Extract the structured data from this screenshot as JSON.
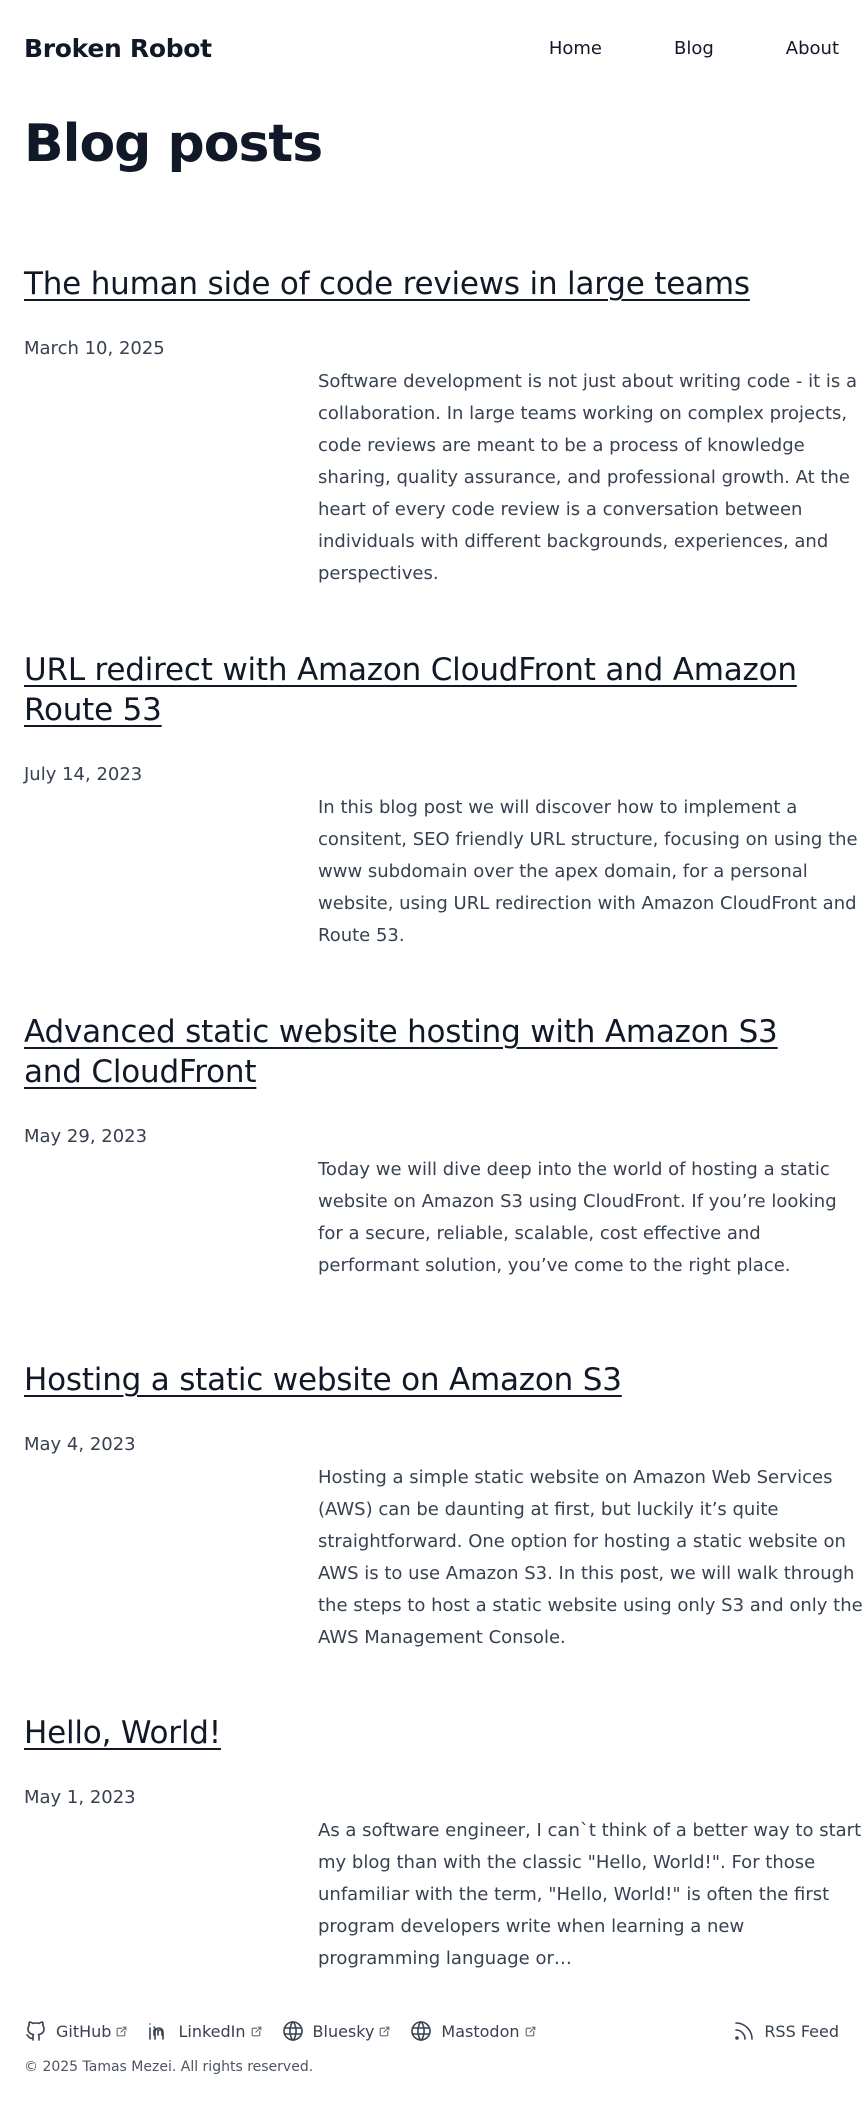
{
  "site": {
    "brand": "Broken Robot",
    "nav": [
      {
        "label": "Home"
      },
      {
        "label": "Blog"
      },
      {
        "label": "About"
      }
    ]
  },
  "page": {
    "title": "Blog posts"
  },
  "posts": [
    {
      "title": "The human side of code reviews in large teams",
      "date": "March 10, 2025",
      "excerpt": "Software development is not just about writing code - it is a collaboration. In large teams working on complex projects, code reviews are meant to be a process of knowledge sharing, quality assurance, and professional growth. At the heart of every code review is a conversation between individuals with different backgrounds, experiences, and perspectives."
    },
    {
      "title": "URL redirect with Amazon CloudFront and Amazon Route 53",
      "date": "July 14, 2023",
      "excerpt": "In this blog post we will discover how to implement a consitent, SEO friendly URL structure, focusing on using the www subdomain over the apex domain, for a personal website, using URL redirection with Amazon CloudFront and Route 53."
    },
    {
      "title": "Advanced static website hosting with Amazon S3 and CloudFront",
      "date": "May 29, 2023",
      "excerpt": "Today we will dive deep into the world of hosting a static website on Amazon S3 using CloudFront. If you’re looking for a secure, reliable, scalable, cost effective and performant solution, you’ve come to the right place."
    },
    {
      "title": "Hosting a static website on Amazon S3",
      "date": "May 4, 2023",
      "excerpt": "Hosting a simple static website on Amazon Web Services (AWS) can be daunting at first, but luckily it’s quite straightforward. One option for hosting a static website on AWS is to use Amazon S3. In this post, we will walk through the steps to host a static website using only S3 and only the AWS Management Console."
    },
    {
      "title": "Hello, World!",
      "date": "May 1, 2023",
      "excerpt": "As a software engineer, I can`t think of a better way to start my blog than with the classic \"Hello, World!\". For those unfamiliar with the term, \"Hello, World!\" is often the first program developers write when learning a new programming language or…"
    }
  ],
  "footer": {
    "social": [
      {
        "label": "GitHub",
        "icon": "github-icon"
      },
      {
        "label": "LinkedIn",
        "icon": "linkedin-icon"
      },
      {
        "label": "Bluesky",
        "icon": "globe-icon"
      },
      {
        "label": "Mastodon",
        "icon": "globe-icon"
      }
    ],
    "rss": {
      "label": "RSS Feed",
      "icon": "rss-icon"
    },
    "copyright": "© 2025 Tamas Mezei. All rights reserved."
  },
  "colors": {
    "text": "#111827",
    "muted": "#374151",
    "background": "#ffffff"
  }
}
